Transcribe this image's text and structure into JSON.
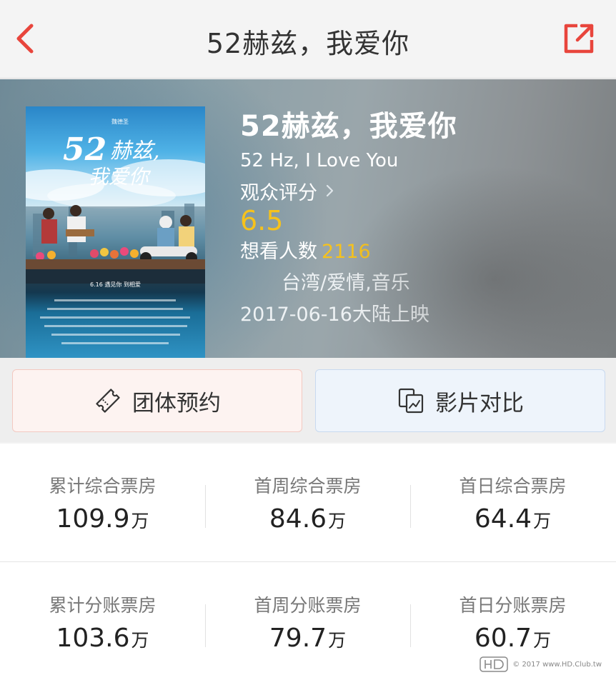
{
  "nav": {
    "title": "52赫兹，我爱你",
    "back_icon": "chevron-left-icon",
    "share_icon": "share-icon",
    "accent": "#e8453c"
  },
  "movie": {
    "title": "52赫兹，我爱你",
    "title_en": "52 Hz, I Love You",
    "rating_label": "观众评分",
    "score": "6.5",
    "want_label": "想看人数",
    "want_count": "2116",
    "genre": "台湾/爱情,音乐",
    "release": "2017-06-16大陆上映",
    "poster_text": {
      "title": "52赫兹，我爱你",
      "date_line": "6.16 遇见你 到相爱"
    }
  },
  "actions": {
    "group_label": "团体预约",
    "group_icon": "ticket-icon",
    "compare_label": "影片对比",
    "compare_icon": "compare-icon"
  },
  "box_office": {
    "unit": "万",
    "rows": [
      [
        {
          "label": "累计综合票房",
          "value": "109.9"
        },
        {
          "label": "首周综合票房",
          "value": "84.6"
        },
        {
          "label": "首日综合票房",
          "value": "64.4"
        }
      ],
      [
        {
          "label": "累计分账票房",
          "value": "103.6"
        },
        {
          "label": "首周分账票房",
          "value": "79.7"
        },
        {
          "label": "首日分账票房",
          "value": "60.7"
        }
      ]
    ]
  },
  "watermark": {
    "text": "© 2017 www.HD.Club.tw"
  },
  "colors": {
    "score": "#f6c21c",
    "accent": "#e8453c"
  }
}
